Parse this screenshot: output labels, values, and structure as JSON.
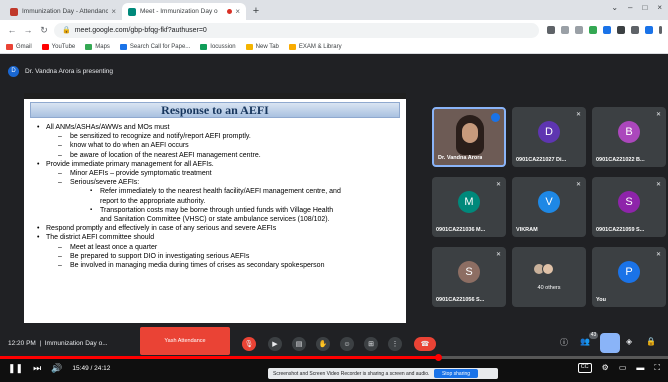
{
  "tabs": [
    {
      "label": "Immunization Day - Attendance",
      "fav_color": "#c0392b"
    },
    {
      "label": "Meet - Immunization Day o",
      "fav_color": "#00897b"
    }
  ],
  "address": {
    "url": "meet.google.com/gbp-bfqg-fkf?authuser=0"
  },
  "bookmarks": [
    "Gmail",
    "YouTube",
    "Maps",
    "Search Call for Pape...",
    "Iocussion",
    "New Tab",
    "EXAM & Library"
  ],
  "presenter": {
    "initial": "D",
    "text": "Dr. Vandna Arora is presenting"
  },
  "slide": {
    "title": "Response to an AEFI",
    "lines": [
      {
        "level": 1,
        "text": "All ANMs/ASHAs/AWWs and MOs must"
      },
      {
        "level": 2,
        "text": "be sensitized to recognize and notify/report AEFI promptly."
      },
      {
        "level": 2,
        "text": "know what to do when an AEFI occurs"
      },
      {
        "level": 2,
        "text": "be aware of location of the nearest AEFI management centre."
      },
      {
        "level": 1,
        "text": "Provide immediate primary management for all AEFIs."
      },
      {
        "level": 2,
        "text": "Minor AEFIs – provide symptomatic treatment"
      },
      {
        "level": 2,
        "text": "Serious/severe AEFIs:"
      },
      {
        "level": 3,
        "text": "Refer immediately to the nearest health facility/AEFI management centre, and"
      },
      {
        "level": 4,
        "text": "report to the appropriate authority."
      },
      {
        "level": 3,
        "text": "Transportation costs may be borne through untied funds with Village Health"
      },
      {
        "level": 4,
        "text": "and Sanitation Committee (VHSC) or state ambulance services (108/102)."
      },
      {
        "level": 1,
        "text": "Respond promptly and effectively in case of any serious and severe AEFIs"
      },
      {
        "level": 1,
        "text": "The district AEFI committee should"
      },
      {
        "level": 2,
        "text": "Meet at least once a quarter"
      },
      {
        "level": 2,
        "text": "Be prepared to support DIO in investigating serious AEFIs"
      },
      {
        "level": 2,
        "text": "Be involved in managing media during times of crises as secondary spokesperson"
      }
    ]
  },
  "participants": [
    {
      "name": "Dr. Vandna Arora",
      "initial": "",
      "color": "",
      "self_video": true
    },
    {
      "name": "0901CA221027 Di...",
      "initial": "D",
      "color": "#5e35b1"
    },
    {
      "name": "0901CA221022 B...",
      "initial": "B",
      "color": "#ab47bc"
    },
    {
      "name": "0901CA221036 M...",
      "initial": "M",
      "color": "#00897b"
    },
    {
      "name": "VIKRAM",
      "initial": "V",
      "color": "#1e88e5"
    },
    {
      "name": "0901CA221059 S...",
      "initial": "S",
      "color": "#8e24aa"
    },
    {
      "name": "0901CA221056 S...",
      "initial": "S",
      "color": "#8d6e63"
    },
    {
      "name": "",
      "initial": "",
      "color": "",
      "others": true,
      "others_label": "40 others"
    },
    {
      "name": "You",
      "initial": "P",
      "color": "#1a73e8"
    }
  ],
  "bar": {
    "time": "12:20 PM",
    "meeting": "Immunization Day o...",
    "overlay_label": "Yash Attendance",
    "people_count": "43"
  },
  "player": {
    "time": "15:49 / 24:12",
    "progress": 0.655,
    "notice": "Screenshot and Screen Video Recorder is sharing a screen and audio.",
    "stop_label": "Stop sharing",
    "cc": "CC"
  }
}
